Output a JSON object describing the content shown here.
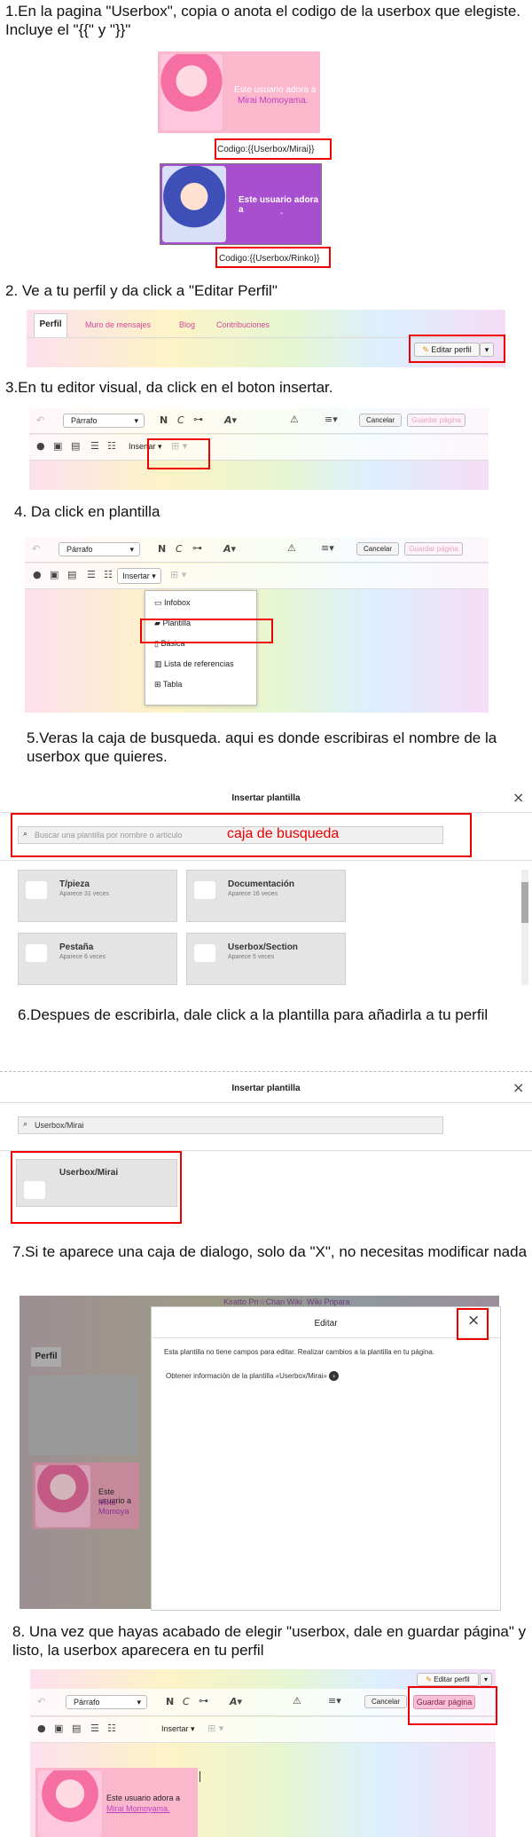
{
  "steps": {
    "s1": "1.En la pagina \"Userbox\", copia o anota el codigo de la userbox que elegiste. Incluye el \"{{\" y \"}}\"",
    "s2": "2. Ve a tu perfil y da click a \"Editar Perfil\"",
    "s3": "3.En tu editor visual, da click en el boton insertar.",
    "s4": "4. Da click en plantilla",
    "s5": "5.Veras la caja de busqueda. aqui es donde escribiras el nombre de la userbox que quieres.",
    "s6": "6.Despues de escribirla, dale click a la plantilla para añadirla a tu perfil",
    "s7": "7.Si te aparece una caja de dialogo, solo da \"X\", no necesitas modificar nada",
    "s8": "8. Una vez que hayas acabado de elegir \"userbox, dale en guardar página\" y listo, la userbox aparecera en tu perfil"
  },
  "userbox1": {
    "text": "Este usuario adora a",
    "name": "Mirai Momoyama.",
    "code": "Codigo:{{Userbox/Mirai}}"
  },
  "userbox2": {
    "text": "Este usuario adora a",
    "name": "-",
    "code": "Codigo:{{Userbox/Rinko}}"
  },
  "profile_tabs": {
    "perfil": "Perfil",
    "muro": "Muro de mensajes",
    "blog": "Blog",
    "contrib": "Contribuciones",
    "edit": "Editar perfil"
  },
  "toolbar": {
    "parrafo": "Párrafo",
    "bold": "N",
    "italic": "C",
    "link": "⊶",
    "style": "A",
    "warn": "⚠",
    "list": "≡",
    "cancel": "Cancelar",
    "save": "Guardar página",
    "insert": "Insertar"
  },
  "insert_menu": [
    "Infobox",
    "Plantilla",
    "Básica",
    "Lista de referencias",
    "Tabla"
  ],
  "dialog": {
    "title": "Insertar plantilla",
    "placeholder": "Buscar una plantilla por nombre o artículo",
    "search_label": "caja de busqueda",
    "cards": [
      {
        "name": "T/pieza",
        "sub": "Aparece 31 veces"
      },
      {
        "name": "Documentación",
        "sub": "Aparece 16 veces"
      },
      {
        "name": "Pestaña",
        "sub": "Aparece 6 veces"
      },
      {
        "name": "Userbox/Section",
        "sub": "Aparece 5 veces"
      }
    ],
    "query": "Userbox/Mirai",
    "result": "Userbox/Mirai"
  },
  "edit_dialog": {
    "title": "Editar",
    "site_title": "Kiratto Pri☆Chan Wiki",
    "site_sub": "Wiki Pripara",
    "desc": "Esta plantilla no tiene campos para editar. Realizar cambios a la plantilla en tu página.",
    "info": "Obtener información de la plantilla «Userbox/Mirai»",
    "perfil": "Perfil",
    "ub_text": "Este usuario a",
    "ub_name": "Mirai Momoya"
  },
  "final": {
    "edit": "Editar perfil",
    "ub_text": "Este usuario adora a",
    "ub_name1": "Mirai",
    "ub_name2": "Momoyama."
  },
  "colors": {
    "red": "#e00000",
    "pink": "#fbb7cc",
    "purple": "#a84fd0",
    "link": "#c040c0"
  }
}
